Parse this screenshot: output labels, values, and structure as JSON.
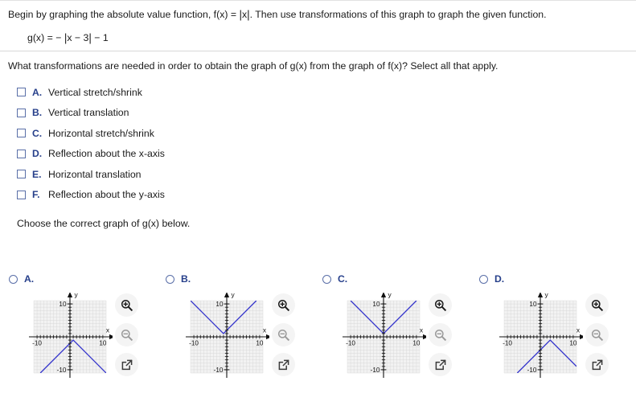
{
  "statement": {
    "line1_a": "Begin by graphing the absolute value function, f(x) = ",
    "line1_abs": "x",
    "line1_b": ". Then use transformations of this graph to graph the given function.",
    "function_label": "g(x) = ",
    "function_neg": "− ",
    "function_inner": "x − 3",
    "function_tail": " − 1"
  },
  "question": {
    "prompt": "What transformations are needed in order to obtain the graph of g(x) from the graph of f(x)? Select all that apply.",
    "choose_prompt": "Choose the correct graph of g(x) below."
  },
  "checkbox_options": [
    {
      "letter": "A.",
      "label": "Vertical stretch/shrink",
      "checked": false
    },
    {
      "letter": "B.",
      "label": "Vertical translation",
      "checked": false
    },
    {
      "letter": "C.",
      "label": "Horizontal stretch/shrink",
      "checked": false
    },
    {
      "letter": "D.",
      "label": "Reflection about the x-axis",
      "checked": false
    },
    {
      "letter": "E.",
      "label": "Horizontal translation",
      "checked": false
    },
    {
      "letter": "F.",
      "label": "Reflection about the y-axis",
      "checked": false
    }
  ],
  "answer_choices": [
    {
      "letter": "A.",
      "selected": false
    },
    {
      "letter": "B.",
      "selected": false
    },
    {
      "letter": "C.",
      "selected": false
    },
    {
      "letter": "D.",
      "selected": false
    }
  ],
  "graphs": {
    "axis_labels": {
      "x": "x",
      "y": "y",
      "x_min": "-10",
      "x_max": "10",
      "y_max": "10",
      "y_min": "-10"
    },
    "axis_range": {
      "xmin": -11,
      "xmax": 11,
      "ymin": -11,
      "ymax": 11
    },
    "grid": true,
    "curve_color": "#3333cc"
  },
  "chart_data": [
    {
      "type": "line",
      "name": "choice-A",
      "title": "A.",
      "xlabel": "x",
      "ylabel": "y",
      "xlim": [
        -11,
        11
      ],
      "ylim": [
        -11,
        11
      ],
      "grid": true,
      "description": "Downward-opening absolute value, vertex (1, -1)",
      "vertex": [
        1,
        -1
      ],
      "orientation": "down",
      "x": [
        -9,
        1,
        11
      ],
      "y": [
        -11,
        -1,
        -11
      ]
    },
    {
      "type": "line",
      "name": "choice-B",
      "title": "B.",
      "xlabel": "x",
      "ylabel": "y",
      "xlim": [
        -11,
        11
      ],
      "ylim": [
        -11,
        11
      ],
      "grid": true,
      "description": "Upward-opening absolute value, vertex (-1, 1)",
      "vertex": [
        -1,
        1
      ],
      "orientation": "up",
      "x": [
        -11,
        -1,
        9
      ],
      "y": [
        11,
        1,
        11
      ]
    },
    {
      "type": "line",
      "name": "choice-C",
      "title": "C.",
      "xlabel": "x",
      "ylabel": "y",
      "xlim": [
        -11,
        11
      ],
      "ylim": [
        -11,
        11
      ],
      "grid": true,
      "description": "Upward-opening absolute value, vertex (0, 1)",
      "vertex": [
        0,
        1
      ],
      "orientation": "up",
      "x": [
        -10,
        0,
        10
      ],
      "y": [
        11,
        1,
        11
      ]
    },
    {
      "type": "line",
      "name": "choice-D",
      "title": "D.",
      "xlabel": "x",
      "ylabel": "y",
      "xlim": [
        -11,
        11
      ],
      "ylim": [
        -11,
        11
      ],
      "grid": true,
      "description": "Downward-opening absolute value, vertex (3, -1)",
      "vertex": [
        3,
        -1
      ],
      "orientation": "down",
      "x": [
        -7,
        3,
        11
      ],
      "y": [
        -11,
        -1,
        -9
      ]
    }
  ],
  "tools": {
    "zoom_in": "zoom-in",
    "zoom_out": "zoom-out",
    "open_popout": "open-in-new-window"
  }
}
